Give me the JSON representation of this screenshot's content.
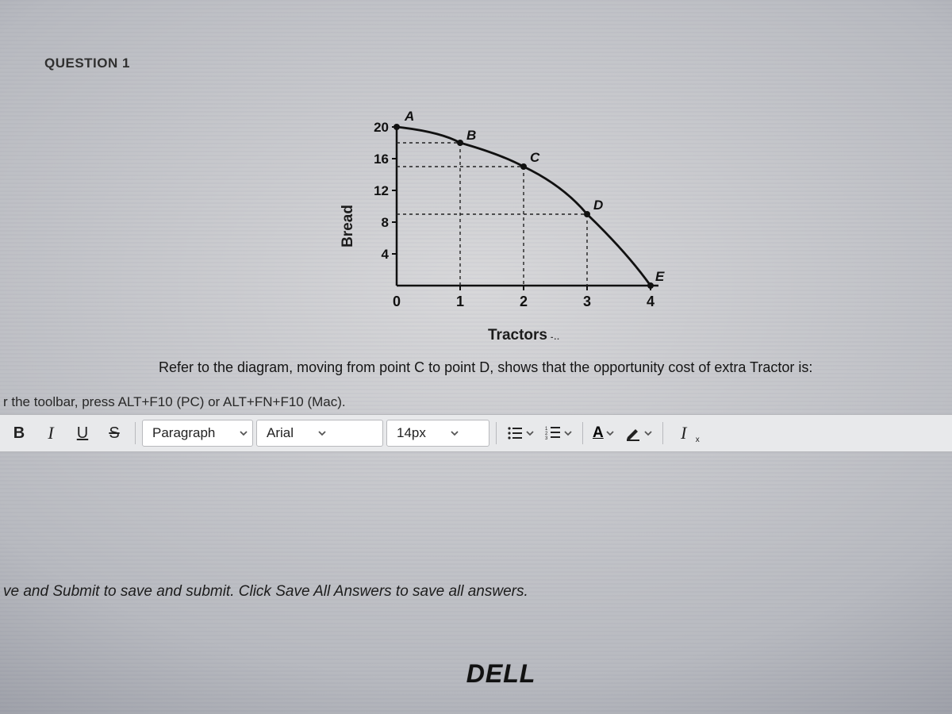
{
  "question_header": "QUESTION 1",
  "question_text": "Refer to the diagram, moving from point C to point D, shows that the opportunity cost of extra Tractor is:",
  "toolbar_hint": "r the toolbar, press ALT+F10 (PC) or ALT+FN+F10 (Mac).",
  "footer_instr": "ve and Submit to save and submit. Click Save All Answers to save all answers.",
  "brand": "DELL",
  "chart_data": {
    "type": "line",
    "title": "",
    "xlabel": "Tractors",
    "ylabel": "Bread",
    "x_ticks": [
      0,
      1,
      2,
      3,
      4
    ],
    "y_ticks": [
      4,
      8,
      12,
      16,
      20
    ],
    "xlim": [
      0,
      4.5
    ],
    "ylim": [
      0,
      22
    ],
    "grid": "dashed",
    "points": [
      {
        "label": "A",
        "x": 0,
        "y": 20
      },
      {
        "label": "B",
        "x": 1,
        "y": 18
      },
      {
        "label": "C",
        "x": 2,
        "y": 15
      },
      {
        "label": "D",
        "x": 3,
        "y": 9
      },
      {
        "label": "E",
        "x": 4,
        "y": 0
      }
    ]
  },
  "toolbar": {
    "bold": "B",
    "italic": "I",
    "underline": "U",
    "strike": "S",
    "paragraph_label": "Paragraph",
    "font_label": "Arial",
    "size_label": "14px",
    "text_color": "A",
    "clear_fmt": "I",
    "clear_fmt_sub": "x"
  }
}
